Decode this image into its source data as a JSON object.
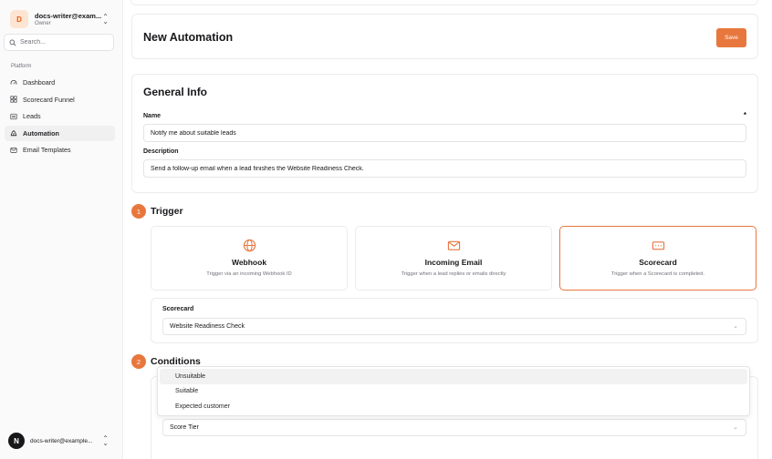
{
  "sidebar": {
    "account": {
      "initial": "D",
      "email": "docs-writer@exam...",
      "role": "Owner"
    },
    "search_placeholder": "Search...",
    "section_label": "Platform",
    "items": [
      {
        "label": "Dashboard",
        "icon": "gauge-icon"
      },
      {
        "label": "Scorecard Funnel",
        "icon": "grid-icon"
      },
      {
        "label": "Leads",
        "icon": "list-icon"
      },
      {
        "label": "Automation",
        "icon": "workflow-icon",
        "active": true
      },
      {
        "label": "Email Templates",
        "icon": "mail-icon"
      }
    ],
    "user": {
      "initial": "N",
      "email": "docs-writer@example..."
    }
  },
  "header": {
    "title": "New Automation",
    "save_label": "Save"
  },
  "general": {
    "title": "General Info",
    "name_label": "Name",
    "required_marker": "*",
    "name_value": "Notify me about suitable leads",
    "description_label": "Description",
    "description_value": "Send a follow-up email when a lead finishes the Website Readiness Check."
  },
  "trigger": {
    "step": "1",
    "title": "Trigger",
    "options": [
      {
        "title": "Webhook",
        "description": "Trigger via an incoming Webhook ID",
        "icon": "globe-icon"
      },
      {
        "title": "Incoming Email",
        "description": "Trigger when a lead replies or emails directly",
        "icon": "mail-icon"
      },
      {
        "title": "Scorecard",
        "description": "Trigger when a Scorecard is completed.",
        "icon": "scorecard-icon",
        "selected": true
      }
    ],
    "scorecard_label": "Scorecard",
    "scorecard_value": "Website Readiness Check"
  },
  "conditions": {
    "step": "2",
    "title": "Conditions",
    "select_value": "Score Tier",
    "dropdown_options": [
      "Unsuitable",
      "Suitable",
      "Expected customer"
    ]
  },
  "colors": {
    "accent": "#e8773e",
    "border": "#ececee"
  }
}
